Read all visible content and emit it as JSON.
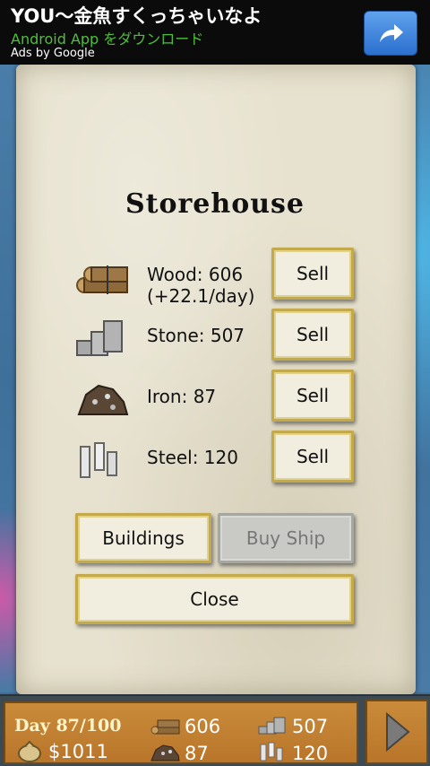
{
  "ad": {
    "title": "YOU〜金魚すくっちゃいなよ",
    "subtitle": "Android App をダウンロード",
    "by": "Ads by Google",
    "action_icon": "share-arrow-icon"
  },
  "storehouse": {
    "title": "Storehouse",
    "resources": [
      {
        "icon": "wood-logs-icon",
        "label": "Wood: 606",
        "extra": "(+22.1/day)",
        "sell": "Sell"
      },
      {
        "icon": "stone-blocks-icon",
        "label": "Stone: 507",
        "sell": "Sell"
      },
      {
        "icon": "iron-ore-icon",
        "label": "Iron: 87",
        "sell": "Sell"
      },
      {
        "icon": "steel-bars-icon",
        "label": "Steel: 120",
        "sell": "Sell"
      }
    ],
    "buttons": {
      "buildings": "Buildings",
      "buy_ship": "Buy Ship",
      "close": "Close"
    }
  },
  "status": {
    "day": "Day  87/100",
    "money": "$1011",
    "wood": "606",
    "stone": "507",
    "iron": "87",
    "steel": "120",
    "next_icon": "play-arrow-icon"
  }
}
